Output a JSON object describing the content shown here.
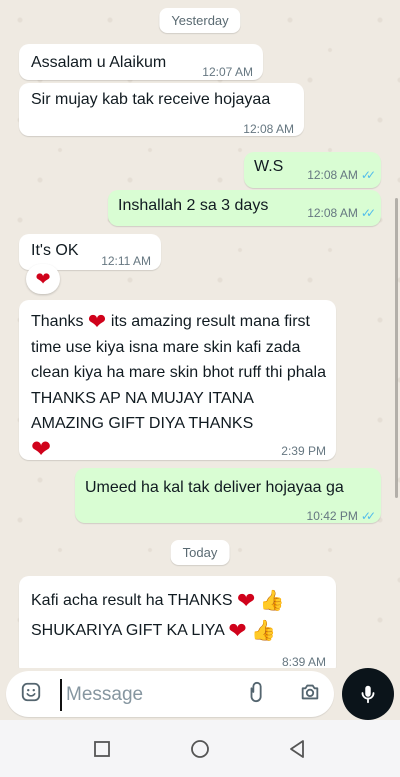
{
  "dates": {
    "yesterday": "Yesterday",
    "today": "Today"
  },
  "messages": [
    {
      "dir": "in",
      "text": "Assalam u Alaikum",
      "time": "12:07 AM"
    },
    {
      "dir": "in",
      "text": "Sir mujay kab tak receive hojayaa",
      "time": "12:08 AM"
    },
    {
      "dir": "out",
      "text": "W.S",
      "time": "12:08 AM",
      "status": "read"
    },
    {
      "dir": "out",
      "text": "Inshallah 2 sa 3 days",
      "time": "12:08 AM",
      "status": "read"
    },
    {
      "dir": "in",
      "text": "It's OK",
      "time": "12:11 AM",
      "reaction": "heart"
    },
    {
      "dir": "in",
      "text_before": "Thanks",
      "text_after": "its amazing result mana first time use kiya isna mare skin kafi zada clean kiya ha mare skin bhot ruff thi phala THANKS AP NA MUJAY ITANA AMAZING GIFT DIYA THANKS",
      "time": "2:39 PM"
    },
    {
      "dir": "out",
      "text": "Umeed ha kal tak deliver hojayaa ga",
      "time": "10:42 PM",
      "status": "read"
    },
    {
      "dir": "in",
      "line1": "Kafi acha result ha THANKS",
      "line2": "SHUKARIYA GIFT KA LIYA",
      "time": "8:39 AM"
    }
  ],
  "composer": {
    "placeholder": "Message"
  },
  "icons": {
    "emoji": "sticker-icon",
    "attach": "paperclip-icon",
    "camera": "camera-icon",
    "mic": "microphone-icon"
  },
  "colors": {
    "incoming": "#ffffff",
    "outgoing": "#d9fdd3",
    "read_tick": "#53bdeb",
    "background": "#efeae2"
  }
}
